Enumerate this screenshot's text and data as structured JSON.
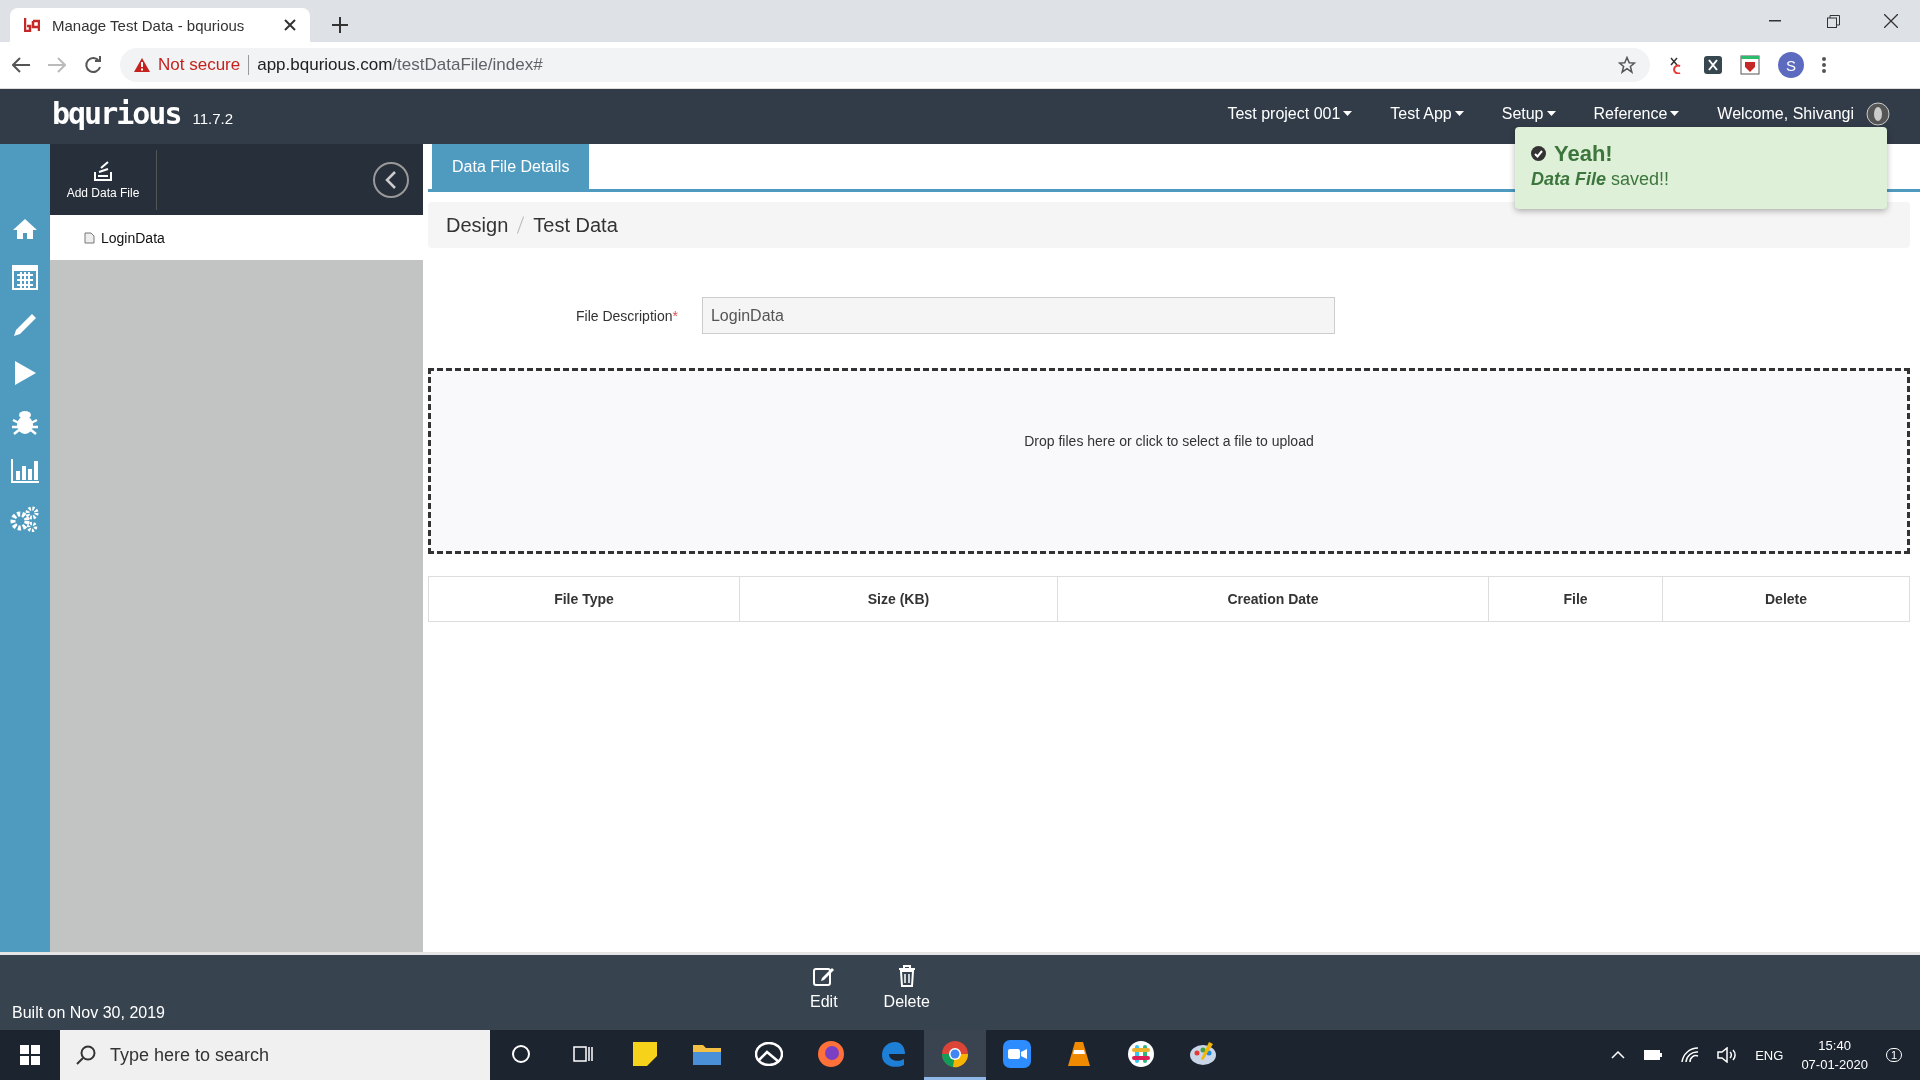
{
  "browser": {
    "tab_title": "Manage Test Data - bqurious",
    "security": "Not secure",
    "url_host": "app.bqurious.com",
    "url_path": "/testDataFile/index#",
    "profile_initial": "S"
  },
  "header": {
    "logo": "bqurious",
    "version": "11.7.2",
    "menus": [
      {
        "label": "Test project 001"
      },
      {
        "label": "Test App"
      },
      {
        "label": "Setup"
      },
      {
        "label": "Reference"
      }
    ],
    "welcome": "Welcome, Shivangi"
  },
  "toast": {
    "title": "Yeah!",
    "message": "**Data File** saved!!"
  },
  "nav_icons": [
    {
      "kind": "home"
    },
    {
      "kind": "calendar"
    },
    {
      "kind": "pencil"
    },
    {
      "kind": "play"
    },
    {
      "kind": "bug"
    },
    {
      "kind": "chart"
    },
    {
      "kind": "gears"
    }
  ],
  "side_panel": {
    "add_button": "Add Data File",
    "files": [
      {
        "name": "LoginData",
        "selected": true
      }
    ]
  },
  "tabs": [
    {
      "label": "Data File Details",
      "selected": true
    }
  ],
  "breadcrumb": [
    "Design",
    "Test Data"
  ],
  "form": {
    "label": "File Description",
    "required_mark": "*",
    "value": "LoginData"
  },
  "dropzone": {
    "text": "Drop files here or click to select a file to upload"
  },
  "table": {
    "columns": [
      "File Type",
      "Size (KB)",
      "Creation Date",
      "File",
      "Delete"
    ]
  },
  "footer": {
    "built": "Built on Nov 30, 2019",
    "actions": [
      {
        "kind": "edit",
        "label": "Edit"
      },
      {
        "kind": "delete",
        "label": "Delete"
      }
    ]
  },
  "taskbar": {
    "search_placeholder": "Type here to search",
    "apps": [
      {
        "kind": "notes",
        "active": false
      },
      {
        "kind": "folder",
        "active": false
      },
      {
        "kind": "photos",
        "active": false
      },
      {
        "kind": "firefox",
        "active": false
      },
      {
        "kind": "edge",
        "active": false
      },
      {
        "kind": "chrome",
        "active": true
      },
      {
        "kind": "zoom",
        "active": false
      },
      {
        "kind": "vlc",
        "active": false
      },
      {
        "kind": "slack",
        "active": false
      },
      {
        "kind": "paint",
        "active": false
      }
    ],
    "language": "ENG",
    "time": "15:40",
    "date": "07-01-2020",
    "notifications": "1"
  }
}
